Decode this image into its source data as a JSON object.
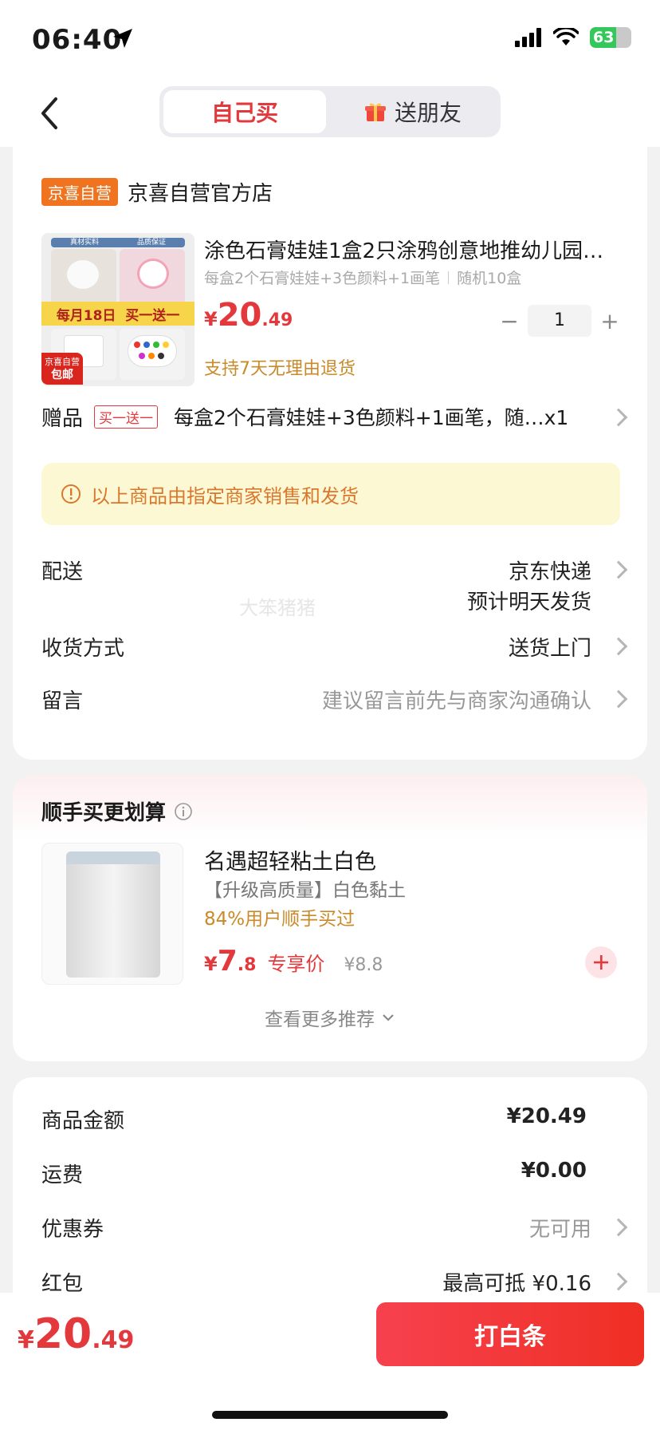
{
  "status": {
    "time": "06:40",
    "battery": "63",
    "battery_level": 0.63
  },
  "header": {
    "tab_self": "自己买",
    "tab_friend": "送朋友"
  },
  "shop": {
    "badge": "京喜自营",
    "name": "京喜自营官方店"
  },
  "product": {
    "image_label_top_left": "真材实料",
    "image_label_top_right": "品质保证",
    "image_promo": "每月18日  买一送一",
    "image_badge_line1": "京喜自营",
    "image_badge_line2": "包邮",
    "title": "涂色石膏娃娃1盒2只涂鸦创意地推幼儿园…",
    "spec": "每盒2个石膏娃娃+3色颜料+1画笔",
    "spec_extra": "随机10盒",
    "price_symbol": "¥",
    "price_int": "20",
    "price_dec": ".49",
    "quantity": "1",
    "qty_minus": "−",
    "qty_plus": "+",
    "return_policy": "支持7天无理由退货"
  },
  "gift": {
    "label": "赠品",
    "tag": "买一送一",
    "text": "每盒2个石膏娃娃+3色颜料+1画笔，随…x1"
  },
  "notice": {
    "text": "以上商品由指定商家销售和发货"
  },
  "delivery": {
    "label": "配送",
    "value": "京东快递",
    "sub": "预计明天发货"
  },
  "receive": {
    "label": "收货方式",
    "value": "送货上门"
  },
  "message": {
    "label": "留言",
    "placeholder": "建议留言前先与商家沟通确认"
  },
  "watermark": "大笨猪猪",
  "addon": {
    "title": "顺手买更划算",
    "item_name": "名遇超轻粘土白色",
    "item_desc": "【升级高质量】白色黏土",
    "item_stat": "84%用户顺手买过",
    "price_symbol": "¥",
    "price_int": "7",
    "price_dec": ".8",
    "price_tag": "专享价",
    "orig_price": "¥8.8",
    "more": "查看更多推荐"
  },
  "summary": {
    "rows": [
      {
        "label": "商品金额",
        "value": "¥20.49"
      },
      {
        "label": "运费",
        "value": "¥0.00"
      },
      {
        "label": "优惠券",
        "value": "无可用"
      },
      {
        "label": "红包",
        "value": "最高可抵 ¥0.16"
      }
    ]
  },
  "footer": {
    "price_symbol": "¥",
    "price_int": "20",
    "price_dec": ".49",
    "pay_label": "打白条"
  },
  "colors": {
    "accent": "#e4393c",
    "orange": "#f0731f",
    "notice_bg": "#fdf8d4",
    "gold": "#c98a2a"
  }
}
